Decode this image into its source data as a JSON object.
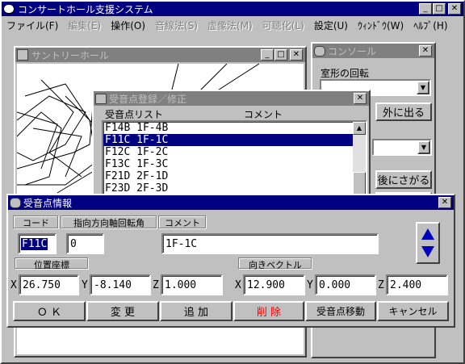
{
  "app": {
    "title": "コンサートホール支援システム",
    "menu": [
      {
        "label": "ファイル(F)",
        "enabled": true
      },
      {
        "label": "編集(E)",
        "enabled": false
      },
      {
        "label": "操作(O)",
        "enabled": true
      },
      {
        "label": "音線法(S)",
        "enabled": false
      },
      {
        "label": "虚像法(M)",
        "enabled": false
      },
      {
        "label": "可聴化(L)",
        "enabled": false
      },
      {
        "label": "設定(U)",
        "enabled": true
      },
      {
        "label": "ｳｨﾝﾄﾞｳ(W)",
        "enabled": true
      },
      {
        "label": "ﾍﾙﾌﾟ(H)",
        "enabled": true
      }
    ]
  },
  "hall_window": {
    "title": "サントリーホール"
  },
  "console_window": {
    "title": "コンソール",
    "room_rotation_label": "室形の回転",
    "go_outside_button": "外に出る",
    "back_button": "後にさがる"
  },
  "register_window": {
    "title": "受音点登録／修正",
    "list_header": "受音点リスト",
    "comment_header": "コメント",
    "items": [
      {
        "code": "F14B",
        "comment": "1F-4B",
        "selected": false
      },
      {
        "code": "F11C",
        "comment": "1F-1C",
        "selected": true
      },
      {
        "code": "F12C",
        "comment": "1F-2C",
        "selected": false
      },
      {
        "code": "F13C",
        "comment": "1F-3C",
        "selected": false
      },
      {
        "code": "F21D",
        "comment": "2F-1D",
        "selected": false
      },
      {
        "code": "F23D",
        "comment": "2F-3D",
        "selected": false
      }
    ]
  },
  "info_dialog": {
    "title": "受音点情報",
    "code_label": "コード",
    "rotation_label": "指向方向軸回転角",
    "comment_label": "コメント",
    "code_value": "F11C",
    "rotation_value": "0",
    "comment_value": "1F-1C",
    "position_label": "位置座標",
    "direction_label": "向きベクトル",
    "position": {
      "x_label": "X",
      "x": "26.750",
      "y_label": "Y",
      "y": "-8.140",
      "z_label": "Z",
      "z": "1.000"
    },
    "direction": {
      "x_label": "X",
      "x": "12.900",
      "y_label": "Y",
      "y": "0.000",
      "z_label": "Z",
      "z": "2.400"
    },
    "buttons": {
      "ok": "Ｏ Ｋ",
      "change": "変 更",
      "add": "追 加",
      "delete": "削 除",
      "move": "受音点移動",
      "cancel": "キャンセル"
    },
    "delete_color": "#ff0000"
  },
  "colors": {
    "active_title": "#000080",
    "inactive_title": "#808080",
    "desktop": "#c0c0c0"
  }
}
